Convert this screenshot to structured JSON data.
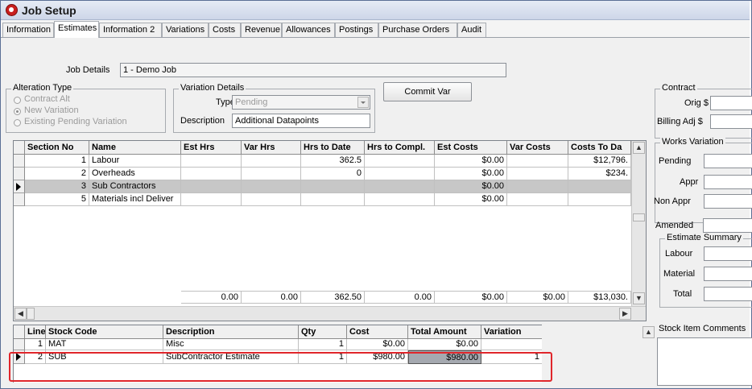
{
  "window": {
    "title": "Job Setup"
  },
  "tabs": [
    "Information",
    "Estimates",
    "Information 2",
    "Variations",
    "Costs",
    "Revenue",
    "Allowances",
    "Postings",
    "Purchase Orders",
    "Audit"
  ],
  "job": {
    "label": "Job Details",
    "value": "1 - Demo Job"
  },
  "alteration": {
    "title": "Alteration Type",
    "options": [
      "Contract Alt",
      "New Variation",
      "Existing Pending Variation"
    ],
    "selected": "New Variation"
  },
  "variation_details": {
    "title": "Variation Details",
    "type_label": "Type",
    "type_value": "Pending",
    "description_label": "Description",
    "description_value": "Additional Datapoints"
  },
  "commit_button": "Commit Var",
  "contract": {
    "title": "Contract",
    "orig_label": "Orig $",
    "billing_label": "Billing Adj $"
  },
  "works_variation": {
    "title": "Works Variation",
    "pending": "Pending",
    "appr": "Appr",
    "non_appr": "Non Appr"
  },
  "amended_label": "Amended",
  "estimate_summary": {
    "title": "Estimate Summary",
    "labour": "Labour",
    "material": "Material",
    "total": "Total"
  },
  "sections_table": {
    "columns": [
      "Section No",
      "Name",
      "Est Hrs",
      "Var Hrs",
      "Hrs to Date",
      "Hrs to Compl.",
      "Est Costs",
      "Var Costs",
      "Costs To Da"
    ],
    "rows": [
      {
        "no": "1",
        "name": "Labour",
        "est_hrs": "",
        "var_hrs": "",
        "hrs_to_date": "362.5",
        "hrs_to_compl": "",
        "est_costs": "$0.00",
        "var_costs": "",
        "costs_to_date": "$12,796."
      },
      {
        "no": "2",
        "name": "Overheads",
        "est_hrs": "",
        "var_hrs": "",
        "hrs_to_date": "0",
        "hrs_to_compl": "",
        "est_costs": "$0.00",
        "var_costs": "",
        "costs_to_date": "$234."
      },
      {
        "no": "3",
        "name": "Sub Contractors",
        "est_hrs": "",
        "var_hrs": "",
        "hrs_to_date": "",
        "hrs_to_compl": "",
        "est_costs": "$0.00",
        "var_costs": "",
        "costs_to_date": ""
      },
      {
        "no": "5",
        "name": "Materials incl Deliver",
        "est_hrs": "",
        "var_hrs": "",
        "hrs_to_date": "",
        "hrs_to_compl": "",
        "est_costs": "$0.00",
        "var_costs": "",
        "costs_to_date": ""
      }
    ],
    "totals": {
      "est_hrs": "0.00",
      "var_hrs": "0.00",
      "hrs_to_date": "362.50",
      "hrs_to_compl": "0.00",
      "est_costs": "$0.00",
      "var_costs": "$0.00",
      "costs_to_date": "$13,030."
    }
  },
  "lines_table": {
    "columns": [
      "Line",
      "Stock Code",
      "Description",
      "Qty",
      "Cost",
      "Total Amount",
      "Variation"
    ],
    "rows": [
      {
        "line": "1",
        "code": "MAT",
        "desc": "Misc",
        "qty": "1",
        "cost": "$0.00",
        "total": "$0.00",
        "variation": ""
      },
      {
        "line": "2",
        "code": "SUB",
        "desc": "SubContractor Estimate",
        "qty": "1",
        "cost": "$980.00",
        "total": "$980.00",
        "variation": "1"
      }
    ]
  },
  "stock_comment_label": "Stock Item Comments",
  "colors": {
    "highlight": "#e0262b",
    "selected_row": "#c7c7c7",
    "titlebar": "#cdd6e8"
  }
}
